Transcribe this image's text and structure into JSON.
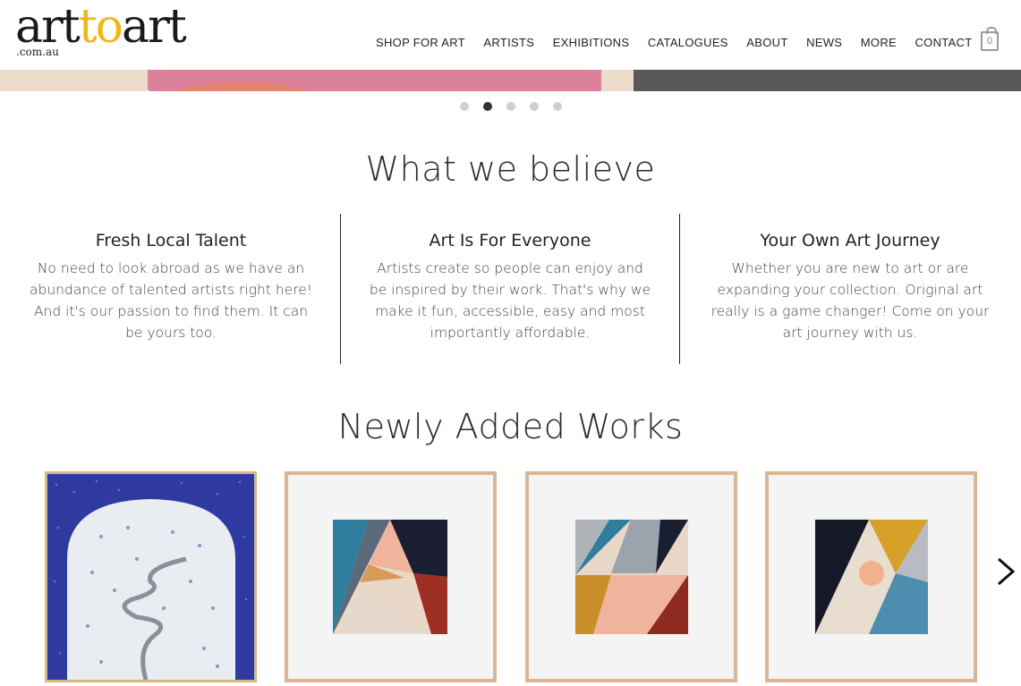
{
  "header": {
    "logo": {
      "part1": "art",
      "part2": "to",
      "part3": "art",
      "sub": ".com.au"
    },
    "nav": [
      {
        "label": "SHOP FOR ART"
      },
      {
        "label": "ARTISTS"
      },
      {
        "label": "EXHIBITIONS"
      },
      {
        "label": "CATALOGUES"
      },
      {
        "label": "ABOUT"
      },
      {
        "label": "NEWS"
      },
      {
        "label": "MORE"
      },
      {
        "label": "CONTACT"
      }
    ],
    "cart_count": "0"
  },
  "slider": {
    "total": 5,
    "active_index": 1
  },
  "believe": {
    "title": "What we believe",
    "columns": [
      {
        "heading": "Fresh Local Talent",
        "text": "No need to look abroad as we have an abundance of talented artists right here! And it's our passion to find them. It can be yours too."
      },
      {
        "heading": "Art Is For Everyone",
        "text": "Artists create so people can enjoy and be inspired by their work. That's why we make it fun, accessible, easy and most importantly affordable."
      },
      {
        "heading": "Your Own Art Journey",
        "text": "Whether you are new to art or are expanding your collection. Original art really is a game changer! Come on your art journey with us."
      }
    ]
  },
  "works": {
    "title": "Newly Added Works"
  },
  "colors": {
    "accent": "#f2b61b",
    "text": "#222222",
    "dot_active": "#333333",
    "dot_inactive": "#cfcfcf"
  },
  "icons": {
    "cart": "shopping-bag-icon",
    "next": "chevron-right-icon"
  }
}
